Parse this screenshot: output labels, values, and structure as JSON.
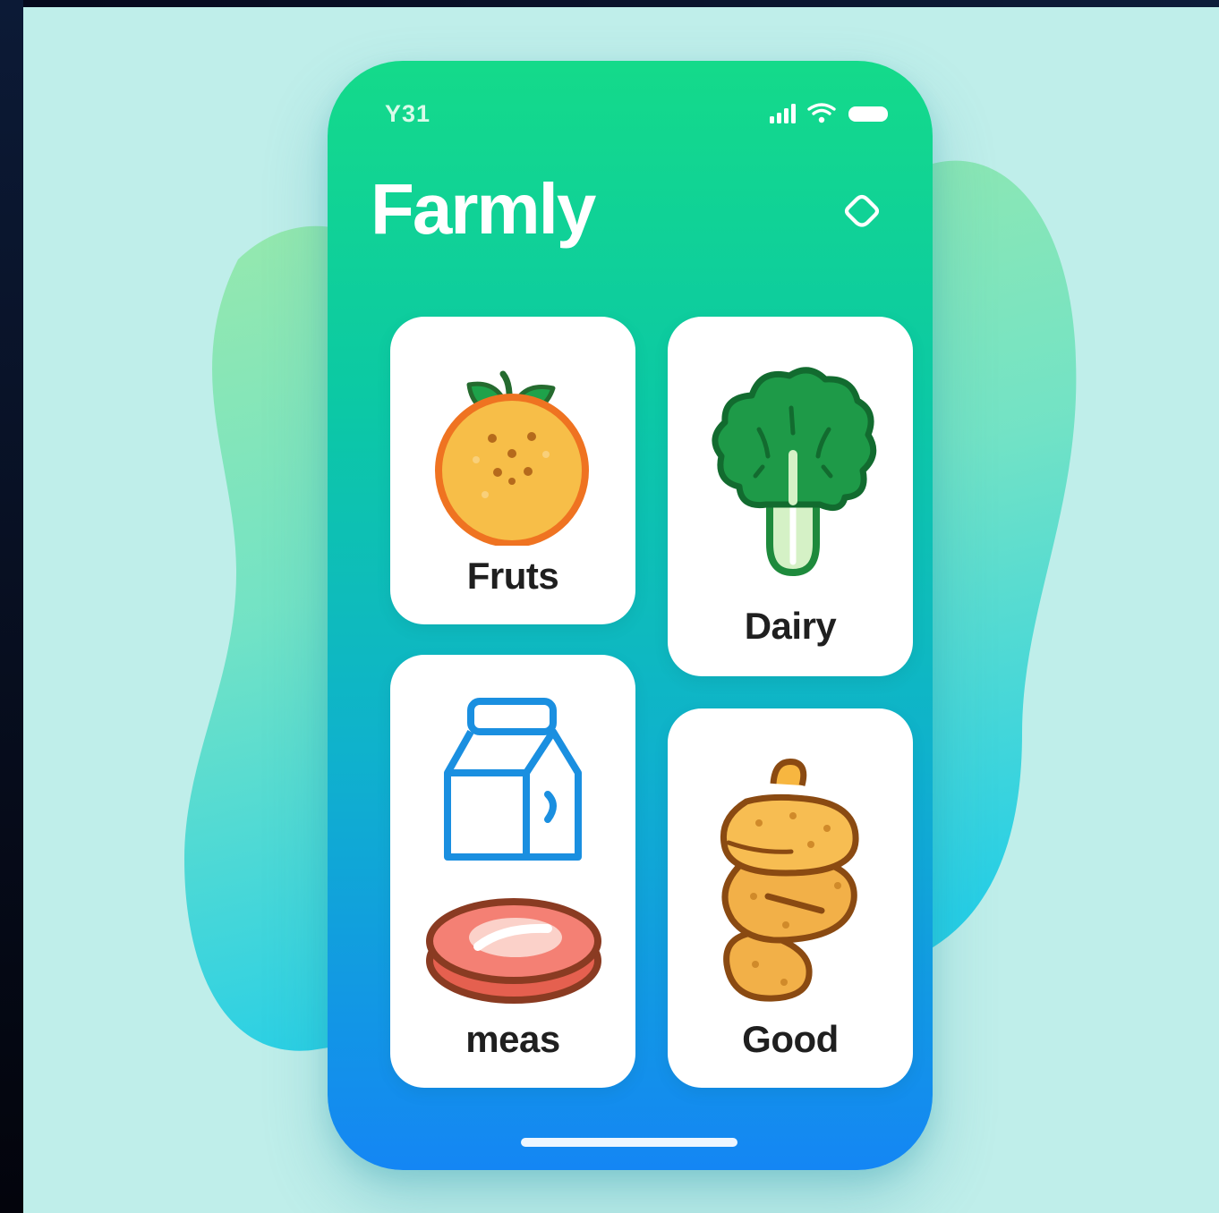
{
  "status_bar": {
    "time": "Y31"
  },
  "header": {
    "title": "Farmly",
    "settings_icon": "settings-icon"
  },
  "categories": [
    {
      "label": "Fruts",
      "icon": "orange-icon"
    },
    {
      "label": "Dairy",
      "icon": "bok-choy-icon"
    },
    {
      "label": "meas",
      "icon": "milk-carton-icon"
    },
    {
      "label": "Good",
      "icon": "bread-icon"
    }
  ],
  "colors": {
    "gradient_top": "#14da8a",
    "gradient_bottom": "#1486f4",
    "background": "#bfeeea",
    "card": "#ffffff"
  }
}
